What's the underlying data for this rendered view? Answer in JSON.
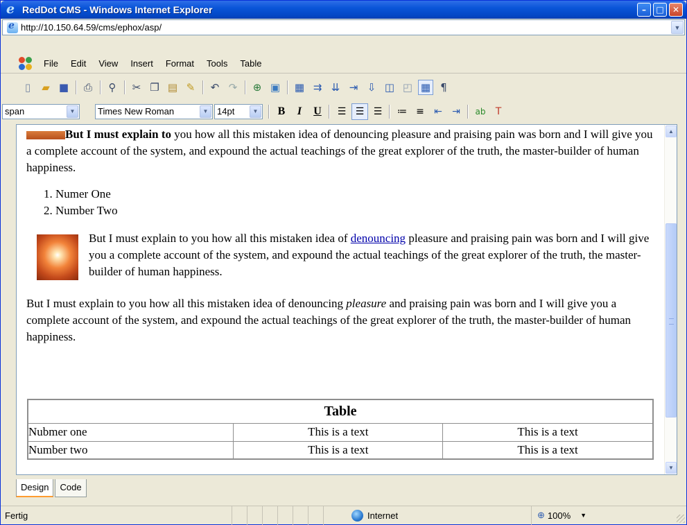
{
  "window": {
    "title": "RedDot CMS - Windows Internet Explorer"
  },
  "address": {
    "url": "http://10.150.64.59/cms/ephox/asp/"
  },
  "menu": [
    "File",
    "Edit",
    "View",
    "Insert",
    "Format",
    "Tools",
    "Table"
  ],
  "format_bar": {
    "style": "span",
    "font": "Times New Roman",
    "size": "14pt"
  },
  "document": {
    "p1_bold": "But I must explain to",
    "p1_rest": " you how all this mistaken idea of denouncing pleasure and praising pain was born and I will give you a complete account of the system, and expound the actual teachings of the great explorer of the truth, the master-builder of human happiness.",
    "list": [
      "Numer One",
      "Number Two"
    ],
    "p2_before": "But I must explain to you how all this mistaken idea of ",
    "p2_link": "denouncing",
    "p2_after": " pleasure and praising pain was born and I will give you a complete account of the system, and expound the actual teachings of the great explorer of the truth, the master-builder of human happiness.",
    "p3_before": "But I must explain to you how all this mistaken idea of denouncing ",
    "p3_italic": "pleasure",
    "p3_after": " and praising pain was born and I will give you a complete account of the system, and expound the actual teachings of the great explorer of the truth, the master-builder of human happiness.",
    "table": {
      "header": "Table",
      "rows": [
        [
          "Nubmer one",
          "This is a text",
          "This is a text"
        ],
        [
          "Number two",
          "This is a text",
          "This is a text"
        ]
      ]
    }
  },
  "tabs": [
    "Design",
    "Code"
  ],
  "status": {
    "text": "Fertig",
    "zone": "Internet",
    "zoom": "100%"
  }
}
